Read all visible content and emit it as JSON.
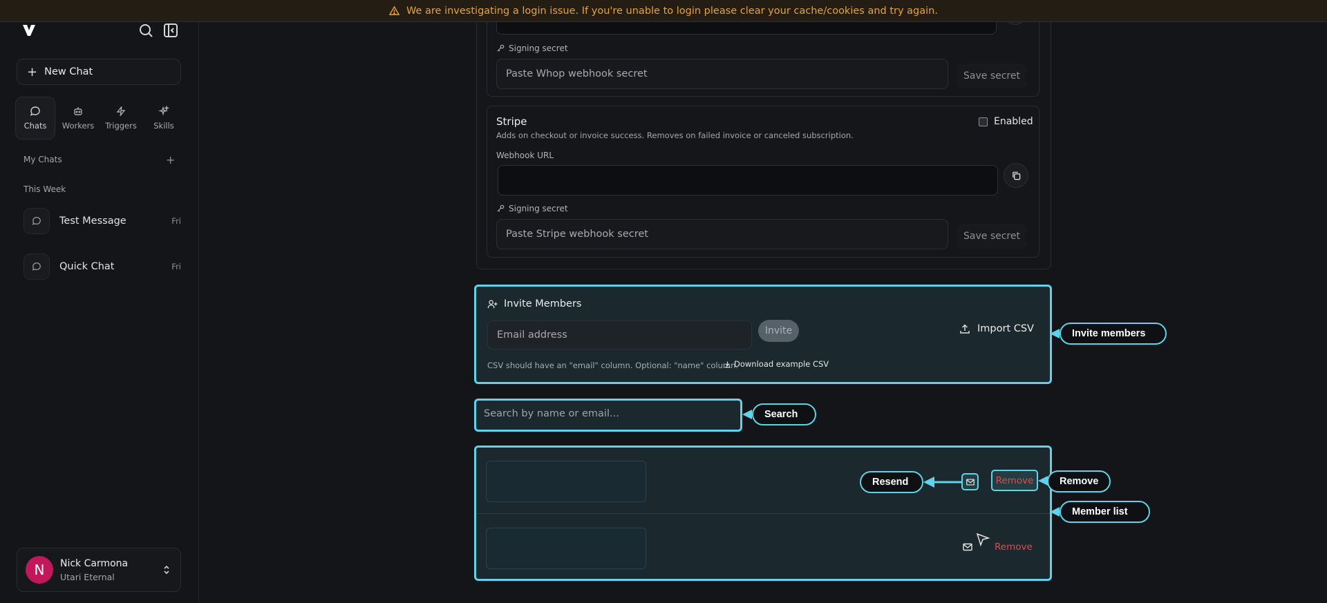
{
  "banner": {
    "text": "We are investigating a login issue. If you're unable to login please clear your cache/cookies and try again."
  },
  "sidebar": {
    "new_chat": "New Chat",
    "nav": [
      {
        "label": "Chats",
        "icon": "chat-bubble-icon"
      },
      {
        "label": "Workers",
        "icon": "robot-icon"
      },
      {
        "label": "Triggers",
        "icon": "lightning-icon"
      },
      {
        "label": "Skills",
        "icon": "sparkle-icon"
      }
    ],
    "my_chats": "My Chats",
    "this_week": "This Week",
    "chats": [
      {
        "title": "Test Message",
        "day": "Fri"
      },
      {
        "title": "Quick Chat",
        "day": "Fri"
      }
    ],
    "user": {
      "initial": "N",
      "name": "Nick Carmona",
      "org": "Utari Eternal"
    }
  },
  "whop": {
    "signing_label": "Signing secret",
    "secret_placeholder": "Paste Whop webhook secret",
    "save": "Save secret"
  },
  "stripe": {
    "title": "Stripe",
    "description": "Adds on checkout or invoice success. Removes on failed invoice or canceled subscription.",
    "enabled_label": "Enabled",
    "webhook_label": "Webhook URL",
    "webhook_value": "",
    "signing_label": "Signing secret",
    "secret_placeholder": "Paste Stripe webhook secret",
    "save": "Save secret"
  },
  "invite": {
    "title": "Invite Members",
    "email_placeholder": "Email address",
    "invite_button": "Invite",
    "import_csv": "Import CSV",
    "csv_hint": "CSV should have an \"email\" column. Optional: \"name\" column.",
    "download_example": "Download example CSV"
  },
  "search": {
    "placeholder": "Search by name or email..."
  },
  "members": {
    "rows": [
      {
        "remove": "Remove"
      },
      {
        "remove": "Remove"
      }
    ]
  },
  "callouts": {
    "invite": "Invite members",
    "search": "Search",
    "resend": "Resend",
    "remove": "Remove",
    "member_list": "Member list"
  },
  "colors": {
    "accent": "#5fd3ea",
    "danger": "#e04b4b",
    "warning": "#e8a23a",
    "avatar": "#c2185b"
  }
}
